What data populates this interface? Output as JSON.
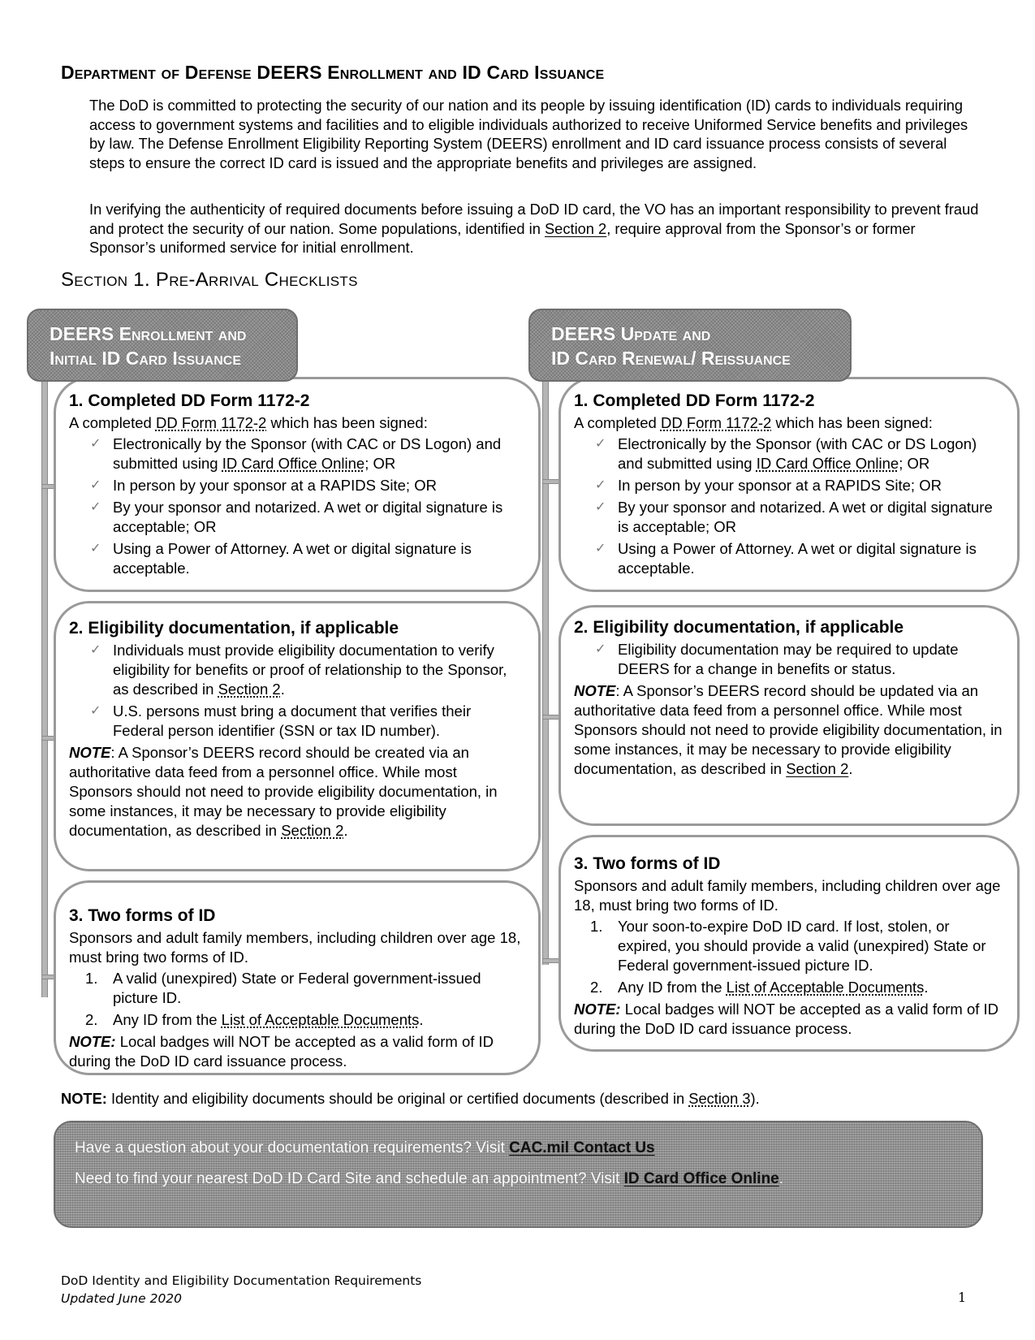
{
  "title": {
    "part1": "Department of Defense",
    "part2": "DEERS",
    "part3": "Enrollment and",
    "part4": "ID",
    "part5": "Card Issuance"
  },
  "intro": {
    "p1": "The DoD is committed to protecting the security of our nation and its people by issuing identification (ID) cards to individuals requiring access to government systems and facilities and to eligible individuals authorized to receive Uniformed Service benefits and privileges by law. The Defense Enrollment Eligibility Reporting System (DEERS) enrollment and ID card issuance process consists of several steps to ensure the correct ID card is issued and the appropriate benefits and privileges are assigned.",
    "p2_before": "In verifying the authenticity of required documents before issuing a DoD ID card, the VO has an important responsibility to prevent fraud and protect the security of our nation.  Some populations, identified in ",
    "p2_link": "Section 2",
    "p2_after": ", require approval from the Sponsor’s or former Sponsor’s uniformed service for initial enrollment."
  },
  "section_heading": "Section 1. Pre-Arrival Checklists",
  "columns": {
    "left": {
      "tab_line1": "DEERS Enrollment and",
      "tab_line2": "Initial ID Card Issuance",
      "box1": {
        "heading": "1.  Completed DD Form 1172-2",
        "intro_before": "A completed ",
        "intro_link": "DD Form 1172-2",
        "intro_after": " which has been signed:",
        "items": [
          {
            "before": "Electronically by the Sponsor (with CAC or DS Logon) and submitted using ",
            "link": "ID Card Office Online",
            "after": "; OR"
          },
          {
            "before": "In person by your sponsor at a RAPIDS Site; OR",
            "link": "",
            "after": ""
          },
          {
            "before": "By your sponsor and notarized.  A wet or digital signature is acceptable; OR",
            "link": "",
            "after": ""
          },
          {
            "before": "Using a Power of Attorney.  A wet or digital signature is acceptable.",
            "link": "",
            "after": ""
          }
        ]
      },
      "box2": {
        "heading": "2. Eligibility documentation, if applicable",
        "items": [
          {
            "before": "Individuals must provide eligibility documentation to verify eligibility for benefits or proof of relationship to the Sponsor, as described in ",
            "link": "Section 2",
            "after": "."
          },
          {
            "before": "U.S. persons must bring a document that verifies their Federal person identifier (SSN or tax ID number).",
            "link": "",
            "after": ""
          }
        ],
        "note_label": "NOTE",
        "note_before": ":  A Sponsor’s DEERS record should be created via an authoritative data feed from a personnel office.  While most Sponsors should not need to provide eligibility documentation, in some instances, it may be necessary to provide eligibility documentation, as described in ",
        "note_link": "Section 2",
        "note_after": "."
      },
      "box3": {
        "heading": "3. Two forms of ID",
        "intro": "Sponsors and adult family members, including children over age 18, must bring two forms of ID.",
        "items": [
          {
            "num": "1.",
            "before": "A valid (unexpired) State or Federal government-issued picture ID.",
            "link": "",
            "after": ""
          },
          {
            "num": "2.",
            "before": "Any ID from the ",
            "link": "List of Acceptable Documents",
            "after": "."
          }
        ],
        "note_label": "NOTE:",
        "note_text": "  Local badges will NOT be accepted as a valid form of ID during the DoD ID card issuance process."
      }
    },
    "right": {
      "tab_line1": "DEERS Update and",
      "tab_line2": "ID Card Renewal/ Reissuance",
      "box1": {
        "heading": "1.  Completed DD Form 1172-2",
        "intro_before": "A completed ",
        "intro_link": "DD Form 1172-2",
        "intro_after": " which has been signed:",
        "items": [
          {
            "before": "Electronically by the Sponsor (with CAC or DS Logon) and submitted using ",
            "link": "ID Card Office Online",
            "after": ";  OR"
          },
          {
            "before": "In person by your sponsor at a RAPIDS Site; OR",
            "link": "",
            "after": ""
          },
          {
            "before": "By your sponsor and notarized.  A wet or digital signature is acceptable; OR",
            "link": "",
            "after": ""
          },
          {
            "before": "Using a Power of Attorney.  A wet or digital signature is acceptable.",
            "link": "",
            "after": ""
          }
        ]
      },
      "box2": {
        "heading": "2. Eligibility documentation, if applicable",
        "items": [
          {
            "before": "Eligibility documentation may be required to update DEERS for a change in benefits or status.",
            "link": "",
            "after": ""
          }
        ],
        "note_label": "NOTE",
        "note_before": ":  A Sponsor’s DEERS record should be updated via an authoritative data feed from a personnel office.  While most Sponsors should not need to provide eligibility documentation, in some instances, it may be necessary to provide eligibility documentation, as described in ",
        "note_link": "Section 2",
        "note_after": "."
      },
      "box3": {
        "heading": "3. Two forms of ID",
        "intro": "Sponsors and adult family members, including children over age 18, must bring two forms of ID.",
        "items": [
          {
            "num": "1.",
            "before": "Your soon-to-expire DoD ID card.  If lost, stolen, or expired, you should provide a valid (unexpired) State or Federal government-issued picture ID.",
            "link": "",
            "after": ""
          },
          {
            "num": "2.",
            "before": "Any ID from the ",
            "link": "List of Acceptable Documents",
            "after": "."
          }
        ],
        "note_label": "NOTE:",
        "note_text": "  Local badges will NOT be accepted as a valid form of ID during the DoD ID card issuance process."
      }
    }
  },
  "bottom_note": {
    "label": "NOTE:",
    "before": "  Identity and eligibility documents should be original or certified documents (described in ",
    "link": "Section 3",
    "after": ")."
  },
  "banner": {
    "line1_text": "Have a question about your documentation requirements?  Visit ",
    "line1_link": "CAC.mil Contact Us",
    "line2_text": "Need to find your nearest DoD ID Card Site and schedule an appointment?  Visit ",
    "line2_link": "ID Card Office Online",
    "line2_after": "."
  },
  "footer": {
    "doc_title": "DoD Identity and Eligibility Documentation Requirements",
    "updated": "Updated June 2020",
    "page_number": "1"
  },
  "icons": {
    "check": "✓"
  },
  "colors": {
    "tab_fill": "#8a8a8a",
    "box_border": "#9a9a9a",
    "tab_text": "#ffffff"
  }
}
